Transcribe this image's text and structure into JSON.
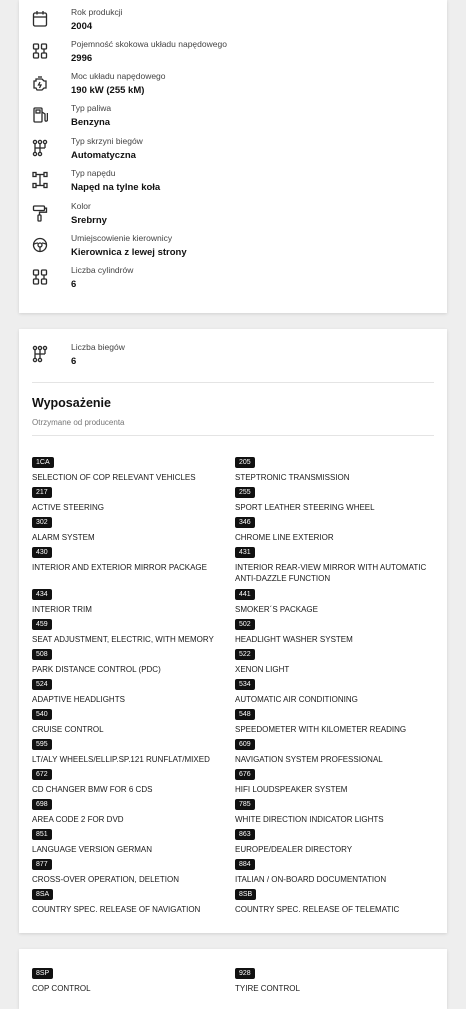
{
  "specs": [
    {
      "icon": "calendar-icon",
      "label": "Rok produkcji",
      "value": "2004"
    },
    {
      "icon": "engine-capacity-icon",
      "label": "Pojemność skokowa układu napędowego",
      "value": "2996"
    },
    {
      "icon": "engine-power-icon",
      "label": "Moc układu napędowego",
      "value": "190 kW (255 kM)"
    },
    {
      "icon": "fuel-pump-icon",
      "label": "Typ paliwa",
      "value": "Benzyna"
    },
    {
      "icon": "gearbox-icon",
      "label": "Typ skrzyni biegów",
      "value": "Automatyczna"
    },
    {
      "icon": "drivetrain-icon",
      "label": "Typ napędu",
      "value": "Napęd na tylne koła"
    },
    {
      "icon": "paint-roller-icon",
      "label": "Kolor",
      "value": "Srebrny"
    },
    {
      "icon": "steering-wheel-icon",
      "label": "Umiejscowienie kierownicy",
      "value": "Kierownica z lewej strony"
    },
    {
      "icon": "cylinders-icon",
      "label": "Liczba cylindrów",
      "value": "6"
    }
  ],
  "gears": {
    "icon": "gearbox-icon",
    "label": "Liczba biegów",
    "value": "6"
  },
  "equipment": {
    "title": "Wyposażenie",
    "source": "Otrzymane od producenta",
    "items": [
      {
        "code": "1CA",
        "name": "SELECTION OF COP RELEVANT VEHICLES"
      },
      {
        "code": "205",
        "name": "STEPTRONIC TRANSMISSION"
      },
      {
        "code": "217",
        "name": "ACTIVE STEERING"
      },
      {
        "code": "255",
        "name": "SPORT LEATHER STEERING WHEEL"
      },
      {
        "code": "302",
        "name": "ALARM SYSTEM"
      },
      {
        "code": "346",
        "name": "CHROME LINE EXTERIOR"
      },
      {
        "code": "430",
        "name": "INTERIOR AND EXTERIOR MIRROR PACKAGE"
      },
      {
        "code": "431",
        "name": "INTERIOR REAR-VIEW MIRROR WITH AUTOMATIC ANTI-DAZZLE FUNCTION"
      },
      {
        "code": "434",
        "name": "INTERIOR TRIM"
      },
      {
        "code": "441",
        "name": "SMOKER´S PACKAGE"
      },
      {
        "code": "459",
        "name": "SEAT ADJUSTMENT, ELECTRIC, WITH MEMORY"
      },
      {
        "code": "502",
        "name": "HEADLIGHT WASHER SYSTEM"
      },
      {
        "code": "508",
        "name": "PARK DISTANCE CONTROL (PDC)"
      },
      {
        "code": "522",
        "name": "XENON LIGHT"
      },
      {
        "code": "524",
        "name": "ADAPTIVE HEADLIGHTS"
      },
      {
        "code": "534",
        "name": "AUTOMATIC AIR CONDITIONING"
      },
      {
        "code": "540",
        "name": "CRUISE CONTROL"
      },
      {
        "code": "548",
        "name": "SPEEDOMETER WITH KILOMETER READING"
      },
      {
        "code": "595",
        "name": "LT/ALY WHEELS/ELLIP.SP.121 RUNFLAT/MIXED"
      },
      {
        "code": "609",
        "name": "NAVIGATION SYSTEM PROFESSIONAL"
      },
      {
        "code": "672",
        "name": "CD CHANGER BMW FOR 6 CDS"
      },
      {
        "code": "676",
        "name": "HIFI LOUDSPEAKER SYSTEM"
      },
      {
        "code": "698",
        "name": "AREA CODE 2 FOR DVD"
      },
      {
        "code": "785",
        "name": "WHITE DIRECTION INDICATOR LIGHTS"
      },
      {
        "code": "851",
        "name": "LANGUAGE VERSION GERMAN"
      },
      {
        "code": "863",
        "name": "EUROPE/DEALER DIRECTORY"
      },
      {
        "code": "877",
        "name": "CROSS-OVER OPERATION, DELETION"
      },
      {
        "code": "884",
        "name": "ITALIAN / ON-BOARD DOCUMENTATION"
      },
      {
        "code": "8SA",
        "name": "COUNTRY SPEC. RELEASE OF NAVIGATION"
      },
      {
        "code": "8SB",
        "name": "COUNTRY SPEC. RELEASE OF TELEMATIC"
      }
    ],
    "more_items": [
      {
        "code": "8SP",
        "name": "COP CONTROL"
      },
      {
        "code": "928",
        "name": "TYIRE CONTROL"
      }
    ]
  }
}
